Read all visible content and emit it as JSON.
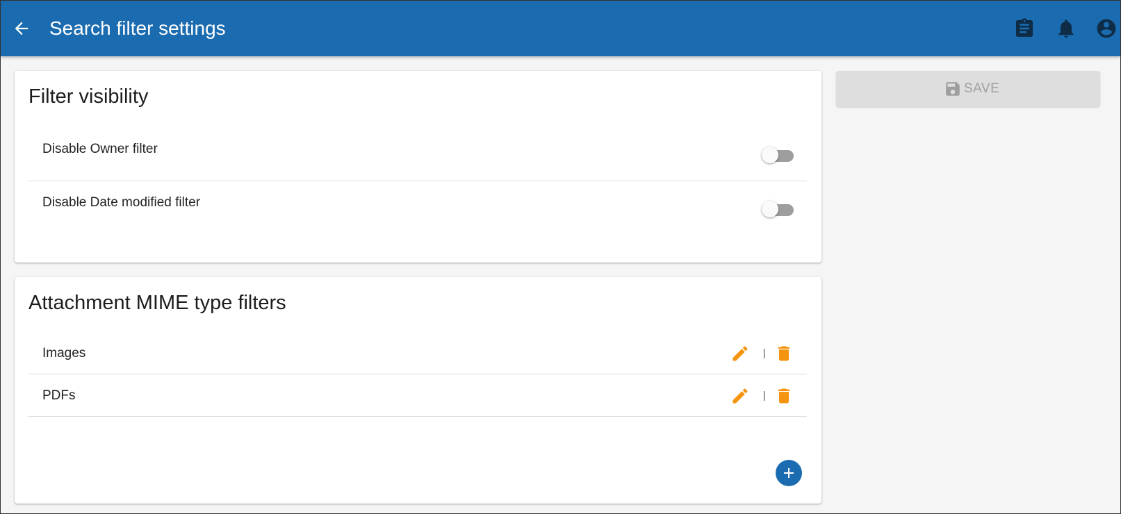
{
  "appbar": {
    "title": "Search filter settings",
    "back_icon": "arrow-back-icon",
    "icons": [
      "clipboard-icon",
      "bell-icon",
      "account-circle-icon"
    ],
    "color": "#1a6bb0"
  },
  "visibility_card": {
    "title": "Filter visibility",
    "rows": [
      {
        "label": "Disable Owner filter",
        "enabled": false
      },
      {
        "label": "Disable Date modified filter",
        "enabled": false
      }
    ]
  },
  "mime_card": {
    "title": "Attachment MIME type filters",
    "rows": [
      {
        "label": "Images"
      },
      {
        "label": "PDFs"
      }
    ],
    "action_color": "#f5950f",
    "add_icon": "add-circle-icon"
  },
  "save": {
    "label": "SAVE",
    "icon": "save-icon",
    "disabled": true
  }
}
